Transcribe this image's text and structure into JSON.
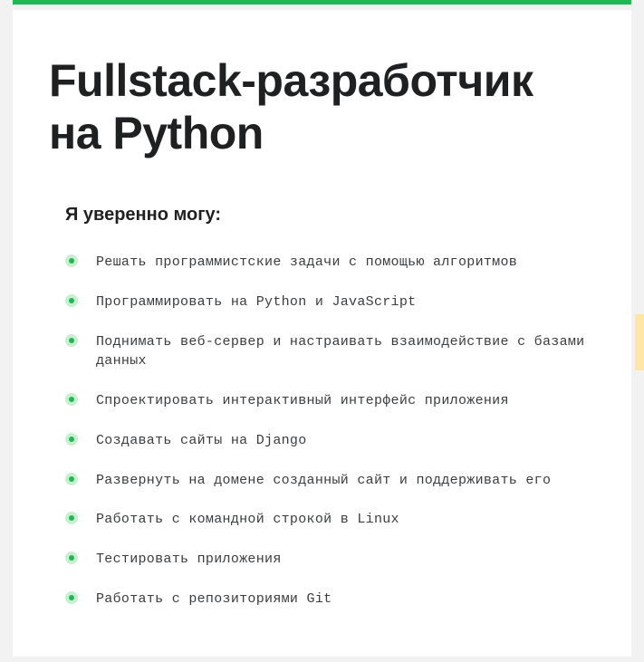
{
  "title": "Fullstack-разработчик на Python",
  "subtitle": "Я уверенно могу:",
  "skills": [
    "Решать программистские задачи с помощью алгоритмов",
    "Программировать на Python и JavaScript",
    "Поднимать веб-сервер и настраивать взаимодействие с базами данных",
    "Спроектировать интерактивный интерфейс приложения",
    "Создавать сайты на Django",
    "Развернуть на домене созданный сайт и поддерживать его",
    "Работать с командной строкой в Linux",
    "Тестировать приложения",
    "Работать с репозиториями Git"
  ]
}
